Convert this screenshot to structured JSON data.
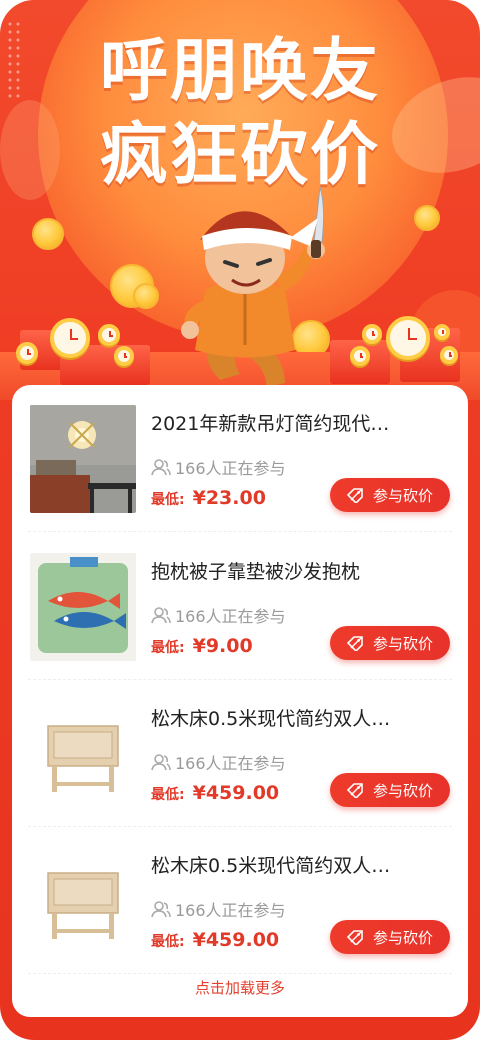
{
  "hero": {
    "title_line1": "呼朋唤友",
    "title_line2": "疯狂砍价"
  },
  "products": [
    {
      "name": "2021年新款吊灯简约现代…",
      "participants": "166人正在参与",
      "price_label": "最低:",
      "price": "¥23.00",
      "button": "参与砍价",
      "image": "wall-lamp"
    },
    {
      "name": "抱枕被子靠垫被沙发抱枕",
      "participants": "166人正在参与",
      "price_label": "最低:",
      "price": "¥9.00",
      "button": "参与砍价",
      "image": "fish-pillow"
    },
    {
      "name": "松木床0.5米现代简约双人…",
      "participants": "166人正在参与",
      "price_label": "最低:",
      "price": "¥459.00",
      "button": "参与砍价",
      "image": "nightstand"
    },
    {
      "name": "松木床0.5米现代简约双人…",
      "participants": "166人正在参与",
      "price_label": "最低:",
      "price": "¥459.00",
      "button": "参与砍价",
      "image": "nightstand"
    }
  ],
  "load_more": "点击加载更多",
  "colors": {
    "primary": "#e8341f",
    "accent": "#ffc93c",
    "price": "#e23a28"
  }
}
